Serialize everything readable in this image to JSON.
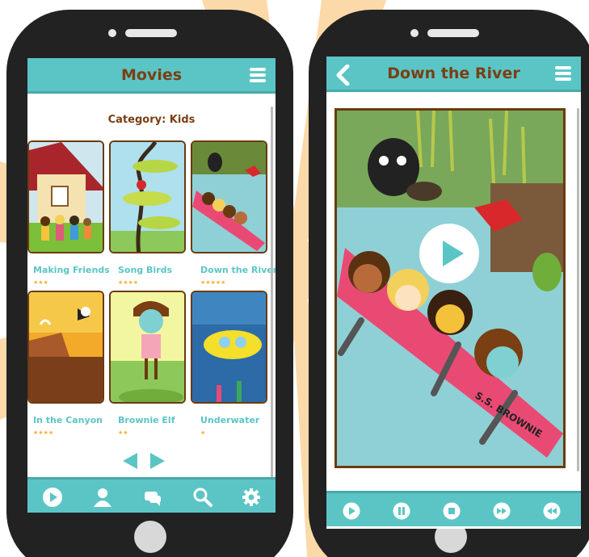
{
  "left_screen": {
    "header": {
      "title": "Movies"
    },
    "category": "Category: Kids",
    "movies": [
      {
        "title": "Making Friends",
        "stars": "★★★"
      },
      {
        "title": "Song Birds",
        "stars": "★★★★"
      },
      {
        "title": "Down the River",
        "stars": "★★★★★"
      },
      {
        "title": "In the Canyon",
        "stars": "★★★★"
      },
      {
        "title": "Brownie Elf",
        "stars": "★★"
      },
      {
        "title": "Underwater",
        "stars": "★"
      }
    ],
    "nav": [
      "play-icon",
      "profile-icon",
      "chat-icon",
      "search-icon",
      "gear-icon"
    ]
  },
  "right_screen": {
    "header": {
      "title": "Down the River"
    },
    "boat_label": "S.S. BROWNIE",
    "controls": [
      "play-icon",
      "pause-icon",
      "stop-icon",
      "fast-forward-icon",
      "rewind-icon"
    ]
  },
  "colors": {
    "teal": "#5bc5c5",
    "brown": "#7a3f12",
    "phone": "#222222",
    "burst": "#fcd9a8",
    "star": "#f5b030"
  }
}
